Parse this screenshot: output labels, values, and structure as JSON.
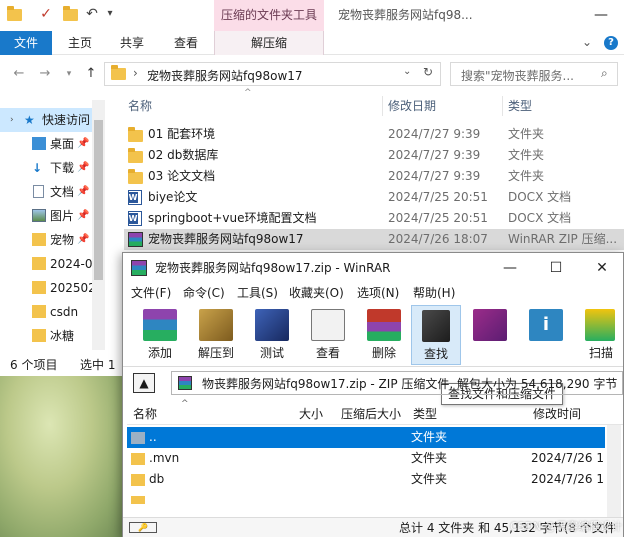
{
  "explorer": {
    "context_tab": "压缩的文件夹工具",
    "window_title": "宠物丧葬服务网站fq98...",
    "ribbon_tabs": [
      "文件",
      "主页",
      "共享",
      "查看",
      "解压缩"
    ],
    "address": "宠物丧葬服务网站fq98ow17",
    "search_placeholder": "搜索\"宠物丧葬服务...",
    "columns": {
      "name": "名称",
      "date": "修改日期",
      "type": "类型"
    },
    "nav": [
      {
        "label": "快速访问",
        "icon": "star-icon"
      },
      {
        "label": "桌面",
        "icon": "desktop-icon"
      },
      {
        "label": "下载",
        "icon": "download-icon"
      },
      {
        "label": "文档",
        "icon": "document-icon"
      },
      {
        "label": "图片",
        "icon": "picture-icon"
      },
      {
        "label": "宠物",
        "icon": "folder-icon"
      },
      {
        "label": "2024-0",
        "icon": "folder-icon"
      },
      {
        "label": "202502",
        "icon": "folder-icon"
      },
      {
        "label": "csdn",
        "icon": "folder-icon"
      },
      {
        "label": "冰糖",
        "icon": "folder-icon"
      }
    ],
    "files": [
      {
        "name": "01 配套环境",
        "date": "2024/7/27 9:39",
        "type": "文件夹",
        "icon": "folder-icon"
      },
      {
        "name": "02 db数据库",
        "date": "2024/7/27 9:39",
        "type": "文件夹",
        "icon": "folder-icon"
      },
      {
        "name": "03 论文文档",
        "date": "2024/7/27 9:39",
        "type": "文件夹",
        "icon": "folder-icon"
      },
      {
        "name": "biye论文",
        "date": "2024/7/25 20:51",
        "type": "DOCX 文档",
        "icon": "word-doc-icon"
      },
      {
        "name": "springboot+vue环境配置文档",
        "date": "2024/7/25 20:51",
        "type": "DOCX 文档",
        "icon": "word-doc-icon"
      },
      {
        "name": "宠物丧葬服务网站fq98ow17",
        "date": "2024/7/26 18:07",
        "type": "WinRAR ZIP 压缩...",
        "icon": "winrar-icon"
      }
    ],
    "status_count": "6 个项目",
    "status_selected": "选中 1"
  },
  "winrar": {
    "title": "宠物丧葬服务网站fq98ow17.zip - WinRAR",
    "menu": [
      "文件(F)",
      "命令(C)",
      "工具(S)",
      "收藏夹(O)",
      "选项(N)",
      "帮助(H)"
    ],
    "toolbar": [
      {
        "label": "添加",
        "icon": "add-archive-icon"
      },
      {
        "label": "解压到",
        "icon": "extract-to-icon"
      },
      {
        "label": "测试",
        "icon": "test-icon"
      },
      {
        "label": "查看",
        "icon": "view-icon"
      },
      {
        "label": "删除",
        "icon": "delete-icon"
      },
      {
        "label": "查找",
        "icon": "find-icon"
      },
      {
        "label": "",
        "icon": "wizard-icon"
      },
      {
        "label": "",
        "icon": "info-icon"
      },
      {
        "label": "扫描",
        "icon": "scan-icon"
      }
    ],
    "tooltip": "查找文件和压缩文件",
    "path": "物丧葬服务网站fq98ow17.zip - ZIP 压缩文件, 解包大小为 54,618,290 字节",
    "columns": {
      "name": "名称",
      "size": "大小",
      "packed": "压缩后大小",
      "type": "类型",
      "modified": "修改时间"
    },
    "rows": [
      {
        "name": "..",
        "type": "文件夹",
        "modified": ""
      },
      {
        "name": ".mvn",
        "type": "文件夹",
        "modified": "2024/7/26 1"
      },
      {
        "name": "db",
        "type": "文件夹",
        "modified": "2024/7/26 1"
      },
      {
        "name": "",
        "type": "",
        "modified": ""
      }
    ],
    "status": "总计 4 文件夹 和 45,132 字节(8 个文件"
  },
  "watermark": "CSDN @黑客编程设计"
}
